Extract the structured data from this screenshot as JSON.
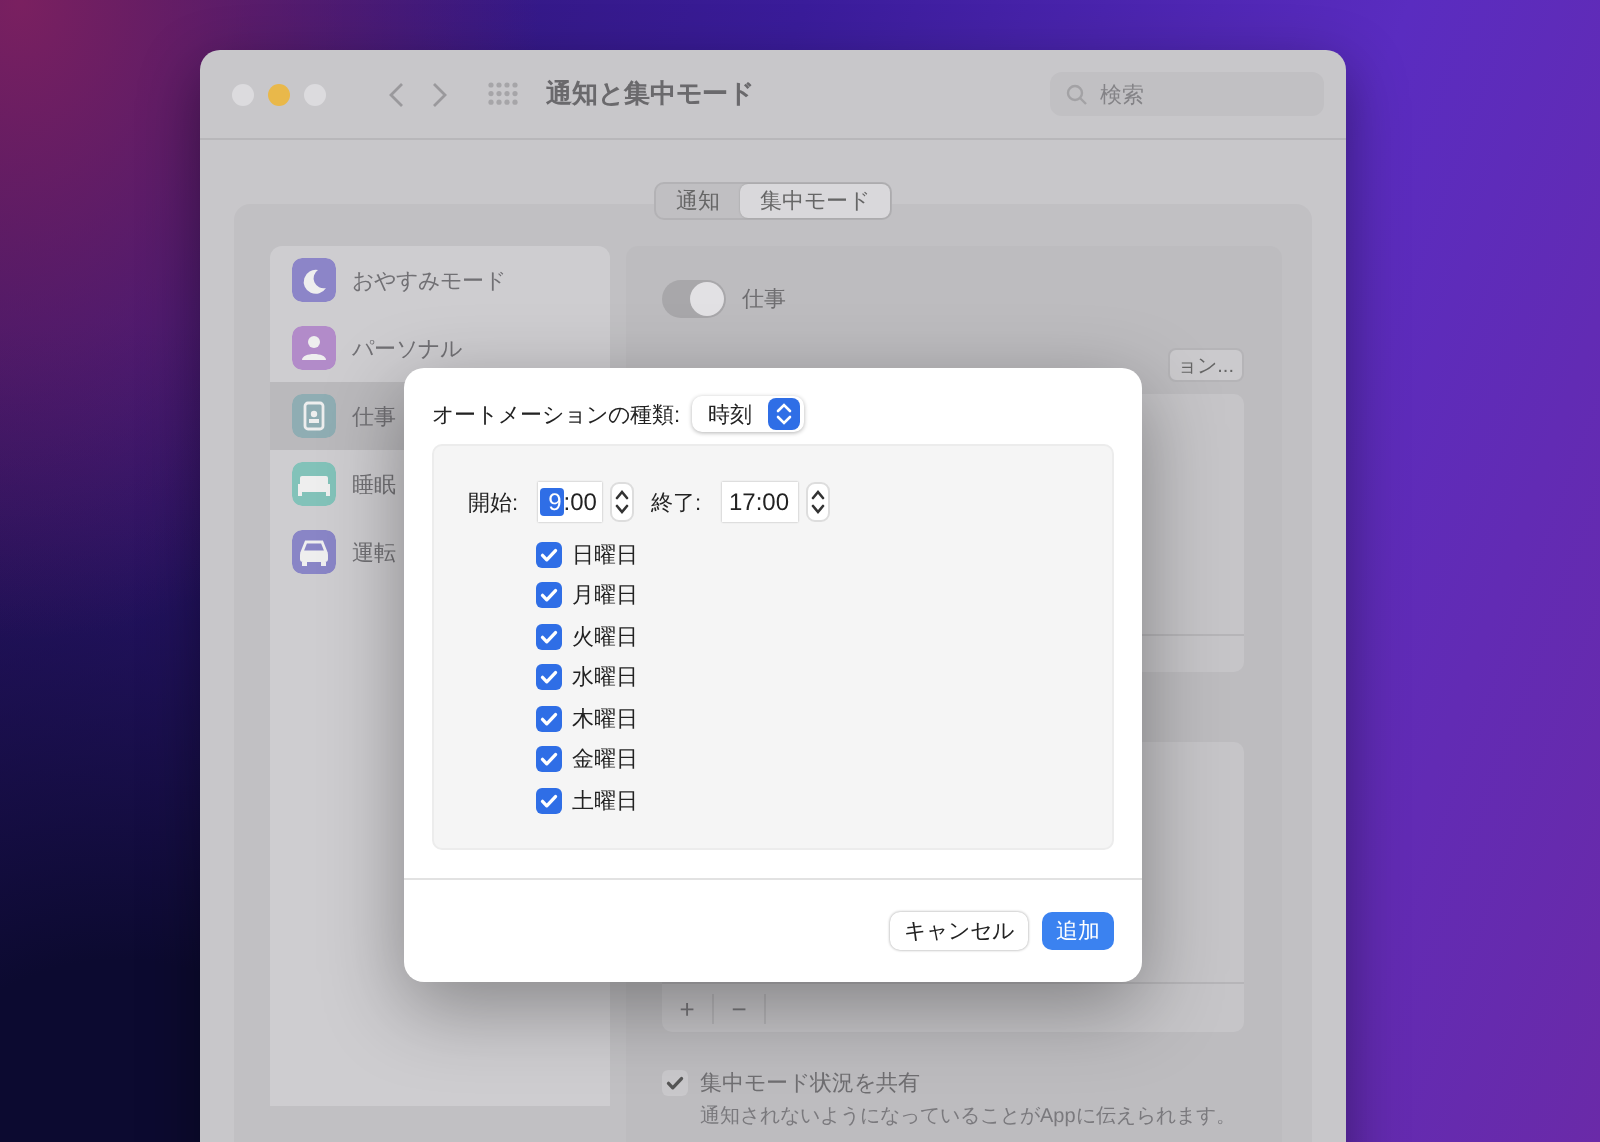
{
  "window": {
    "title": "通知と集中モード",
    "search_placeholder": "検索"
  },
  "tabs": [
    {
      "label": "通知",
      "selected": false
    },
    {
      "label": "集中モード",
      "selected": true
    }
  ],
  "sidebar": {
    "items": [
      {
        "label": "おやすみモード",
        "kind": "moon",
        "color": "#8c85c8",
        "selected": false
      },
      {
        "label": "パーソナル",
        "kind": "person",
        "color": "#b28bc9",
        "selected": false
      },
      {
        "label": "仕事",
        "kind": "badge",
        "color": "#8fadb3",
        "selected": true
      },
      {
        "label": "睡眠",
        "kind": "bed",
        "color": "#82c2b9",
        "selected": false
      },
      {
        "label": "運転",
        "kind": "car",
        "color": "#8985c6",
        "selected": false
      }
    ]
  },
  "detail": {
    "mode_toggle": {
      "label": "仕事",
      "on": true
    },
    "options_button": "ョン...",
    "list_buttons": [
      "+",
      "−"
    ],
    "share_status": {
      "label": "集中モード状況を共有",
      "checked": true,
      "description": "通知されないようになっていることがAppに伝えられます。"
    }
  },
  "dialog": {
    "type_label": "オートメーションの種類:",
    "type_value": "時刻",
    "start_label": "開始:",
    "start_time": {
      "selected_part": "9",
      "rest": ":00"
    },
    "end_label": "終了:",
    "end_time": "17:00",
    "days": [
      {
        "label": "日曜日",
        "checked": true
      },
      {
        "label": "月曜日",
        "checked": true
      },
      {
        "label": "火曜日",
        "checked": true
      },
      {
        "label": "水曜日",
        "checked": true
      },
      {
        "label": "木曜日",
        "checked": true
      },
      {
        "label": "金曜日",
        "checked": true
      },
      {
        "label": "土曜日",
        "checked": true
      }
    ],
    "buttons": [
      {
        "label": "キャンセル",
        "kind": "secondary"
      },
      {
        "label": "追加",
        "kind": "primary"
      }
    ]
  }
}
